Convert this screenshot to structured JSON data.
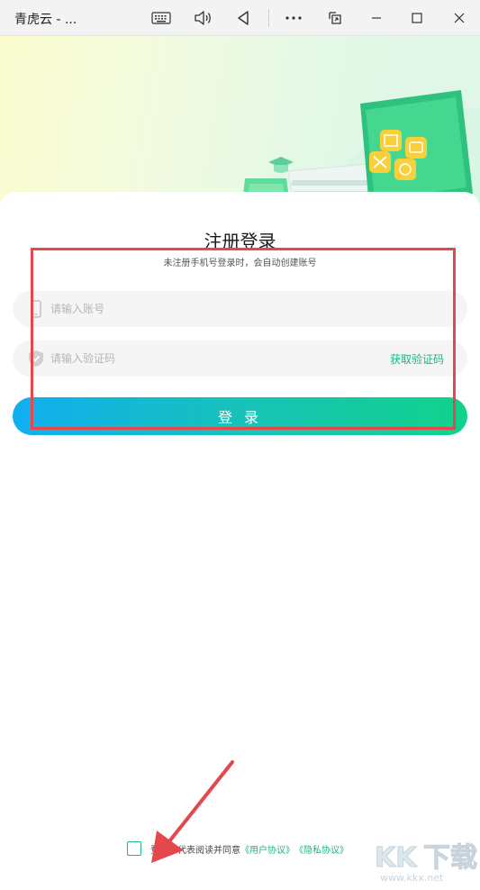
{
  "window": {
    "title": "青虎云 - ...",
    "buttons": [
      "keyboard-icon",
      "volume-icon",
      "back-icon",
      "more-icon",
      "screenshot-icon",
      "minimize-icon",
      "maximize-icon",
      "close-icon"
    ]
  },
  "form": {
    "title": "注册登录",
    "subtitle": "未注册手机号登录时，会自动创建账号",
    "account_placeholder": "请输入账号",
    "code_placeholder": "请输入验证码",
    "get_code_label": "获取验证码",
    "login_label": "登 录"
  },
  "agreement": {
    "prefix": "登录即代表阅读并同意",
    "user_agreement": "《用户协议》",
    "privacy_agreement": "《隐私协议》",
    "checked": false
  },
  "watermark": {
    "logo_text": "KK下载",
    "url": "www.kkx.net"
  },
  "colors": {
    "accent": "#1bb389",
    "gradient_start": "#11aef0",
    "gradient_end": "#10d28a",
    "annotation": "#e4474d"
  }
}
